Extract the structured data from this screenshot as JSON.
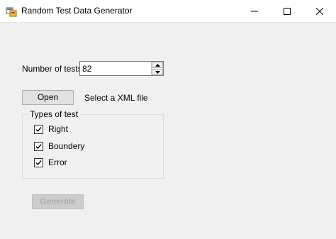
{
  "window": {
    "title": "Random Test Data Generator"
  },
  "form": {
    "number_of_tests_label": "Number of tests",
    "number_of_tests_value": "82",
    "open_button": "Open",
    "file_hint": "Select a XML file",
    "types_group_label": "Types of test",
    "checkboxes": [
      {
        "label": "Right",
        "checked": true
      },
      {
        "label": "Boundery",
        "checked": true
      },
      {
        "label": "Error",
        "checked": true
      }
    ],
    "generate_button": "Generate",
    "generate_enabled": false
  },
  "icons": {
    "app": "app-icon",
    "minimize": "minimize-icon",
    "maximize": "maximize-icon",
    "close": "close-icon",
    "spin_up": "chevron-up-icon",
    "spin_down": "chevron-down-icon",
    "check": "checkmark-icon"
  }
}
